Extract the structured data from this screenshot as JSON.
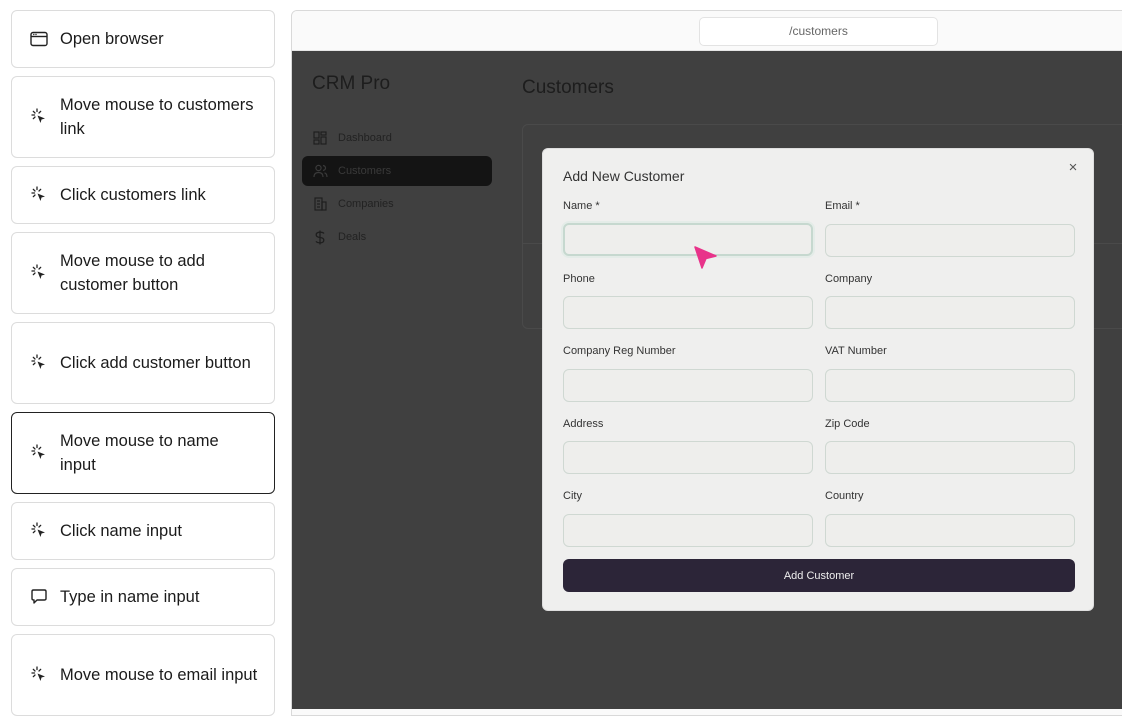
{
  "steps": [
    {
      "label": "Open browser",
      "icon": "browser-window-icon"
    },
    {
      "label": "Move mouse to customers link",
      "icon": "pointer-click-icon"
    },
    {
      "label": "Click customers link",
      "icon": "pointer-click-icon"
    },
    {
      "label": "Move mouse to add customer button",
      "icon": "pointer-click-icon"
    },
    {
      "label": "Click add customer button",
      "icon": "pointer-click-icon"
    },
    {
      "label": "Move mouse to name input",
      "icon": "pointer-click-icon",
      "active": true
    },
    {
      "label": "Click name input",
      "icon": "pointer-click-icon"
    },
    {
      "label": "Type in name input",
      "icon": "speech-bubble-icon"
    },
    {
      "label": "Move mouse to email input",
      "icon": "pointer-click-icon"
    }
  ],
  "browser": {
    "url": "/customers"
  },
  "app": {
    "brand": "CRM Pro",
    "nav": [
      {
        "label": "Dashboard",
        "icon": "dashboard-grid-icon"
      },
      {
        "label": "Customers",
        "icon": "users-icon",
        "selected": true
      },
      {
        "label": "Companies",
        "icon": "building-icon"
      },
      {
        "label": "Deals",
        "icon": "dollar-icon"
      }
    ],
    "page_title": "Customers"
  },
  "modal": {
    "title": "Add New Customer",
    "fields": {
      "name": {
        "label": "Name *",
        "value": ""
      },
      "email": {
        "label": "Email *",
        "value": ""
      },
      "phone": {
        "label": "Phone",
        "value": ""
      },
      "company": {
        "label": "Company",
        "value": ""
      },
      "company_reg": {
        "label": "Company Reg Number",
        "value": ""
      },
      "vat": {
        "label": "VAT Number",
        "value": ""
      },
      "address": {
        "label": "Address",
        "value": ""
      },
      "zip": {
        "label": "Zip Code",
        "value": ""
      },
      "city": {
        "label": "City",
        "value": ""
      },
      "country": {
        "label": "Country",
        "value": ""
      }
    },
    "submit_label": "Add Customer",
    "close_glyph": "×"
  },
  "colors": {
    "cursor": "#e8338a",
    "submit_bg": "#2c2538",
    "overlay": "#404040"
  }
}
